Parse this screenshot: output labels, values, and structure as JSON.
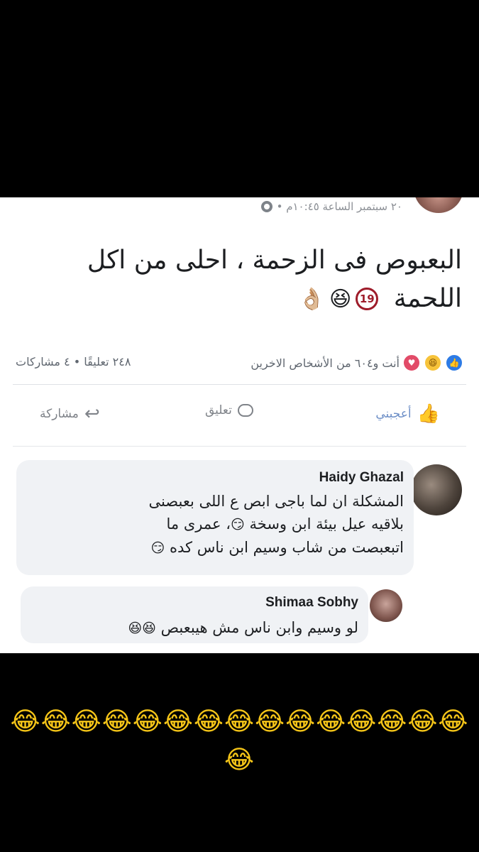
{
  "post": {
    "meta": "٢٠ سبتمبر الساعة ١٠:٤٥م •",
    "text_line1": "البعبوص فى الزحمة ، احلى من اكل",
    "text_line2": "اللحمة",
    "badge": "19",
    "emoji_laugh": "😆",
    "emoji_ok": "👌🏼"
  },
  "stats": {
    "reactions_text": "أنت و٦٠٤ من الأشخاص الاخرين",
    "counts_text": "٢٤٨ تعليقًا • ٤ مشاركات"
  },
  "actions": {
    "like_label": "أعجبني",
    "comment_label": "تعليق",
    "share_label": "مشاركة"
  },
  "comments": [
    {
      "name": "Haidy Ghazal",
      "line1": "المشكلة ان لما باجى ابص ع اللى بعبصنى",
      "line2": "بلاقيه عيل بيئة ابن وسخة",
      "line2b": "، عمرى ما",
      "line3": "اتبعبصت من شاب وسيم ابن ناس كده",
      "emoji": "😏"
    },
    {
      "name": "Shimaa Sobhy",
      "line1": "لو وسيم وابن ناس مش هيبعبص",
      "emoji": "😆😆"
    }
  ],
  "caption": {
    "line1": "😂😂😂😂😂😂😂😂😂😂😂😂😂😂😂",
    "line2": "😂"
  }
}
